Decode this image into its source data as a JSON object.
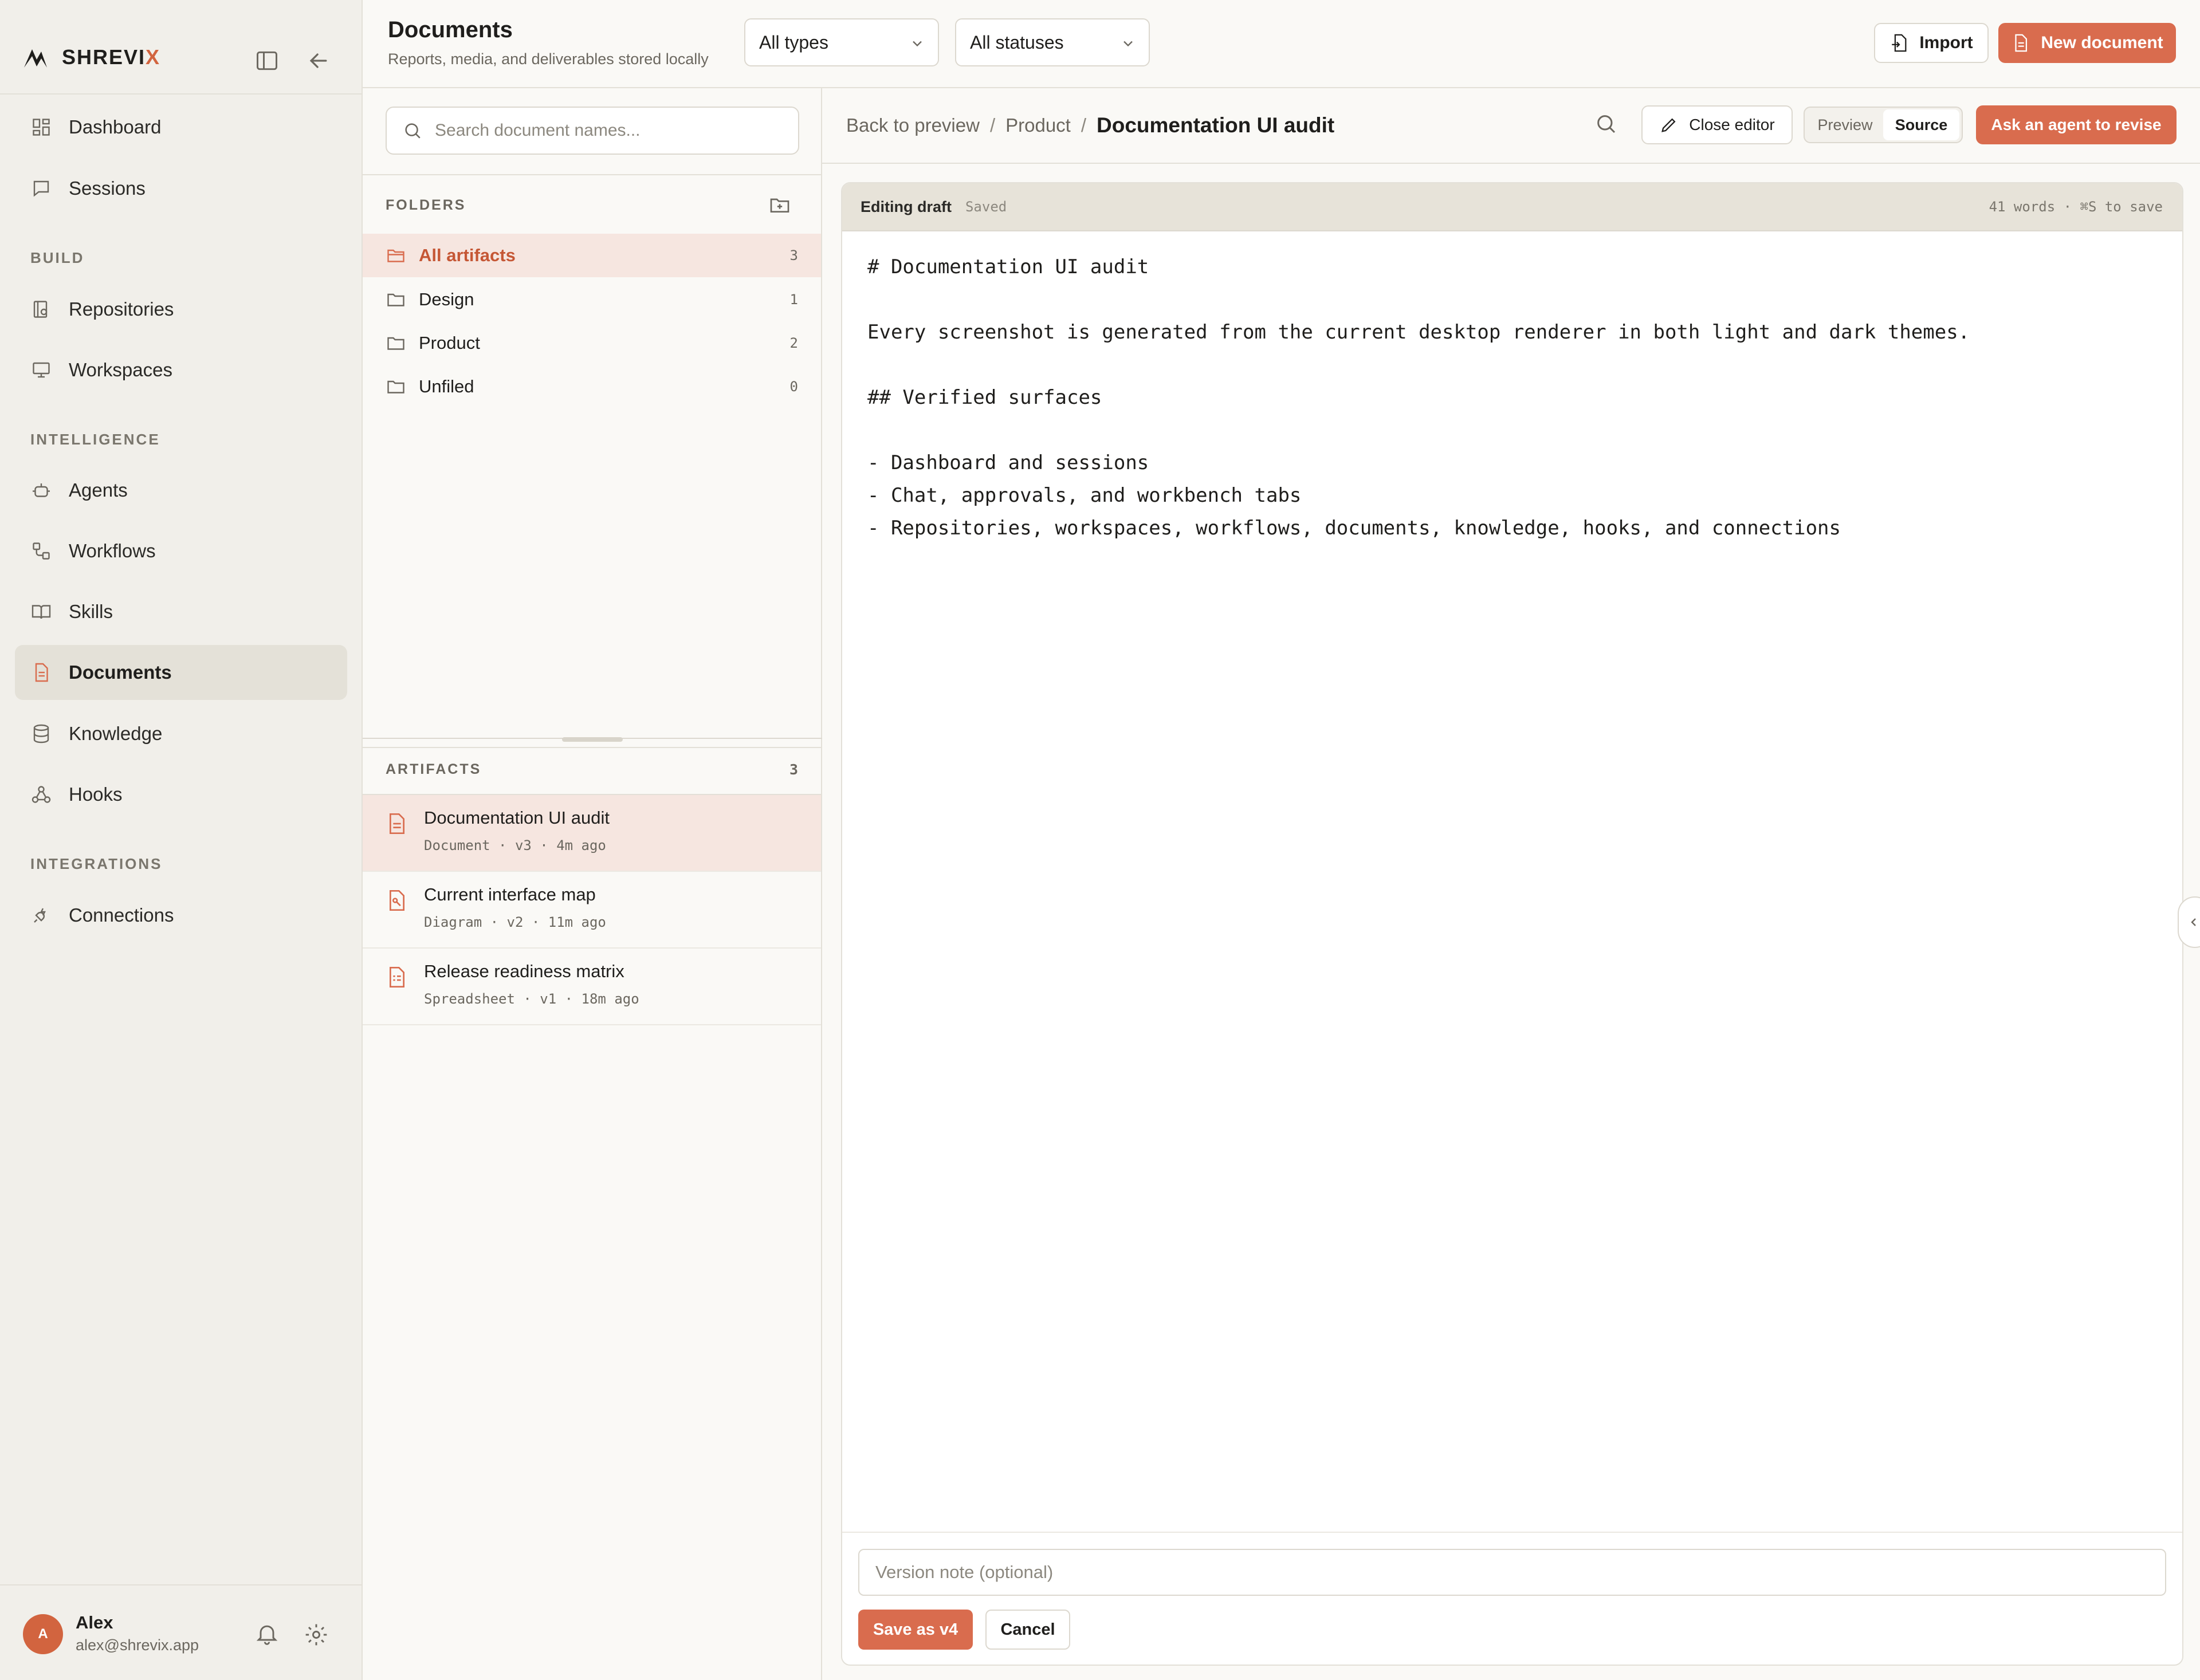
{
  "brand": {
    "name_prefix": "SHREVI",
    "name_suffix": "X"
  },
  "sidebar": {
    "items_top": [
      {
        "label": "Dashboard",
        "icon": "dashboard-icon"
      },
      {
        "label": "Sessions",
        "icon": "chat-icon"
      }
    ],
    "section_build": "BUILD",
    "items_build": [
      {
        "label": "Repositories",
        "icon": "repository-icon"
      },
      {
        "label": "Workspaces",
        "icon": "monitor-icon"
      }
    ],
    "section_intelligence": "INTELLIGENCE",
    "items_intelligence": [
      {
        "label": "Agents",
        "icon": "bot-icon"
      },
      {
        "label": "Workflows",
        "icon": "workflow-icon"
      },
      {
        "label": "Skills",
        "icon": "book-icon"
      },
      {
        "label": "Documents",
        "icon": "document-icon",
        "active": true
      },
      {
        "label": "Knowledge",
        "icon": "database-icon"
      },
      {
        "label": "Hooks",
        "icon": "webhook-icon"
      }
    ],
    "section_integrations": "INTEGRATIONS",
    "items_integrations": [
      {
        "label": "Connections",
        "icon": "plug-icon"
      }
    ]
  },
  "user": {
    "initial": "A",
    "name": "Alex",
    "email": "alex@shrevix.app"
  },
  "header": {
    "title": "Documents",
    "subtitle": "Reports, media, and deliverables stored locally",
    "type_filter": "All types",
    "status_filter": "All statuses",
    "import_label": "Import",
    "new_label": "New document"
  },
  "middle": {
    "search_placeholder": "Search document names...",
    "folders_label": "FOLDERS",
    "folders": [
      {
        "name": "All artifacts",
        "count": "3",
        "active": true
      },
      {
        "name": "Design",
        "count": "1"
      },
      {
        "name": "Product",
        "count": "2"
      },
      {
        "name": "Unfiled",
        "count": "0"
      }
    ],
    "artifacts_label": "ARTIFACTS",
    "artifacts_count": "3",
    "artifacts": [
      {
        "name": "Documentation UI audit",
        "meta": "Document · v3 · 4m ago",
        "icon": "document-icon",
        "active": true
      },
      {
        "name": "Current interface map",
        "meta": "Diagram · v2 · 11m ago",
        "icon": "diagram-file-icon"
      },
      {
        "name": "Release readiness matrix",
        "meta": "Spreadsheet · v1 · 18m ago",
        "icon": "spreadsheet-icon"
      }
    ]
  },
  "editor_view": {
    "breadcrumb": {
      "back": "Back to preview",
      "folder": "Product",
      "current": "Documentation UI audit"
    },
    "close_editor": "Close editor",
    "toggle_preview": "Preview",
    "toggle_source": "Source",
    "ask_agent": "Ask an agent to revise",
    "draft_label": "Editing draft",
    "saved_status": "Saved",
    "stats": "41 words · ⌘S to save",
    "content_lines": [
      "# Documentation UI audit",
      "",
      "Every screenshot is generated from the current desktop renderer in both light and dark themes.",
      "",
      "## Verified surfaces",
      "",
      "- Dashboard and sessions",
      "- Chat, approvals, and workbench tabs",
      "- Repositories, workspaces, workflows, documents, knowledge, hooks, and connections"
    ],
    "version_note_placeholder": "Version note (optional)",
    "save_label": "Save as v4",
    "cancel_label": "Cancel"
  },
  "colors": {
    "accent": "#d96c4e",
    "accent_text": "#c55735",
    "active_bg": "#f6e6e0",
    "sidebar_bg": "#f1efea"
  }
}
